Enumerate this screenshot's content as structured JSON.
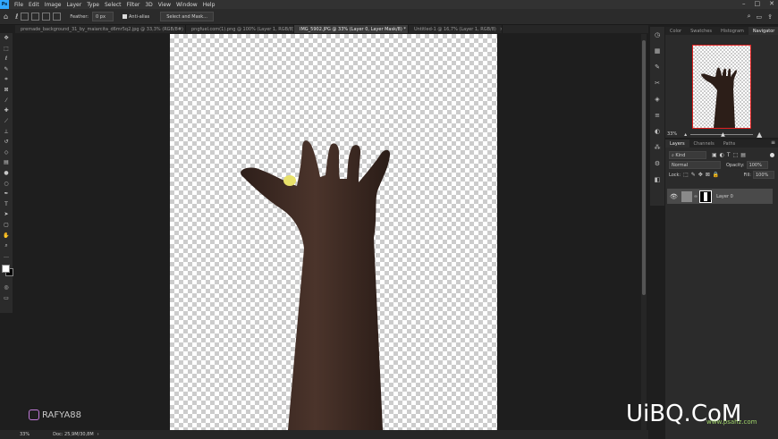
{
  "app": {
    "logo": "Ps"
  },
  "menu": [
    "File",
    "Edit",
    "Image",
    "Layer",
    "Type",
    "Select",
    "Filter",
    "3D",
    "View",
    "Window",
    "Help"
  ],
  "options": {
    "feather_label": "Feather:",
    "feather_value": "0 px",
    "antialias_label": "Anti-alias",
    "select_mask_label": "Select and Mask..."
  },
  "tabs": [
    {
      "label": "premade_background_31_by_maiarcita_d6mr5q2.jpg @ 33,3% (RGB/8#)",
      "active": false
    },
    {
      "label": "pngfuel.com(1).png @ 100% (Layer 1, RGB/8)",
      "active": false
    },
    {
      "label": "IMG_5902.JPG @ 33% (Layer 0, Layer Mask/8) *",
      "active": true
    },
    {
      "label": "Untitled-1 @ 16,7% (Layer 1, RGB/8)",
      "active": false
    }
  ],
  "status": {
    "zoom": "33%",
    "doc": "Doc: 25,9M/30,8M"
  },
  "tools": [
    "move-icon",
    "marquee-icon",
    "lasso-icon",
    "quick-select-icon",
    "crop-icon",
    "frame-icon",
    "eyedropper-icon",
    "healing-icon",
    "brush-icon",
    "clone-stamp-icon",
    "history-brush-icon",
    "eraser-icon",
    "gradient-icon",
    "blur-icon",
    "dodge-icon",
    "pen-icon",
    "type-icon",
    "path-select-icon",
    "rectangle-icon",
    "hand-icon",
    "zoom-icon",
    "more-tools-icon"
  ],
  "nav_panel": {
    "tabs": [
      "Color",
      "Swatches",
      "Histogram",
      "Navigator"
    ],
    "active": "Navigator",
    "zoom": "33%"
  },
  "layers_panel": {
    "tabs": [
      "Layers",
      "Channels",
      "Paths"
    ],
    "active": "Layers",
    "filter_kind": "Kind",
    "blend_mode": "Normal",
    "opacity_label": "Opacity:",
    "opacity_value": "100%",
    "lock_label": "Lock:",
    "fill_label": "Fill:",
    "fill_value": "100%",
    "layer_name": "Layer 0"
  },
  "watermarks": {
    "rafya": "RAFYA88",
    "uibq": "UiBQ.CoM",
    "site": "www.psahz.com"
  },
  "colors": {
    "accent": "#31a8ff",
    "panel": "#2b2b2b",
    "bg": "#1e1e1e",
    "selected_layer": "#4a4a4a"
  }
}
